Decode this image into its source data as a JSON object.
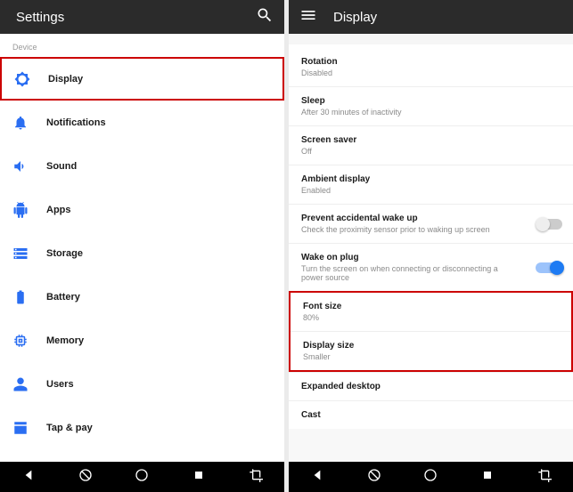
{
  "left": {
    "title": "Settings",
    "section": "Device",
    "items": [
      {
        "label": "Display",
        "icon": "brightness"
      },
      {
        "label": "Notifications",
        "icon": "bell"
      },
      {
        "label": "Sound",
        "icon": "volume"
      },
      {
        "label": "Apps",
        "icon": "android"
      },
      {
        "label": "Storage",
        "icon": "storage"
      },
      {
        "label": "Battery",
        "icon": "battery"
      },
      {
        "label": "Memory",
        "icon": "memory"
      },
      {
        "label": "Users",
        "icon": "user"
      },
      {
        "label": "Tap & pay",
        "icon": "tap"
      }
    ]
  },
  "right": {
    "title": "Display",
    "items": [
      {
        "title": "Rotation",
        "sub": "Disabled"
      },
      {
        "title": "Sleep",
        "sub": "After 30 minutes of inactivity"
      },
      {
        "title": "Screen saver",
        "sub": "Off"
      },
      {
        "title": "Ambient display",
        "sub": "Enabled"
      },
      {
        "title": "Prevent accidental wake up",
        "sub": "Check the proximity sensor prior to waking up screen",
        "toggle": "off"
      },
      {
        "title": "Wake on plug",
        "sub": "Turn the screen on when connecting or disconnecting a power source",
        "toggle": "on"
      },
      {
        "title": "Font size",
        "sub": "80%"
      },
      {
        "title": "Display size",
        "sub": "Smaller"
      },
      {
        "title": "Expanded desktop",
        "sub": ""
      },
      {
        "title": "Cast",
        "sub": ""
      }
    ]
  },
  "colors": {
    "accent": "#2a6ef2",
    "highlight": "#c00"
  }
}
